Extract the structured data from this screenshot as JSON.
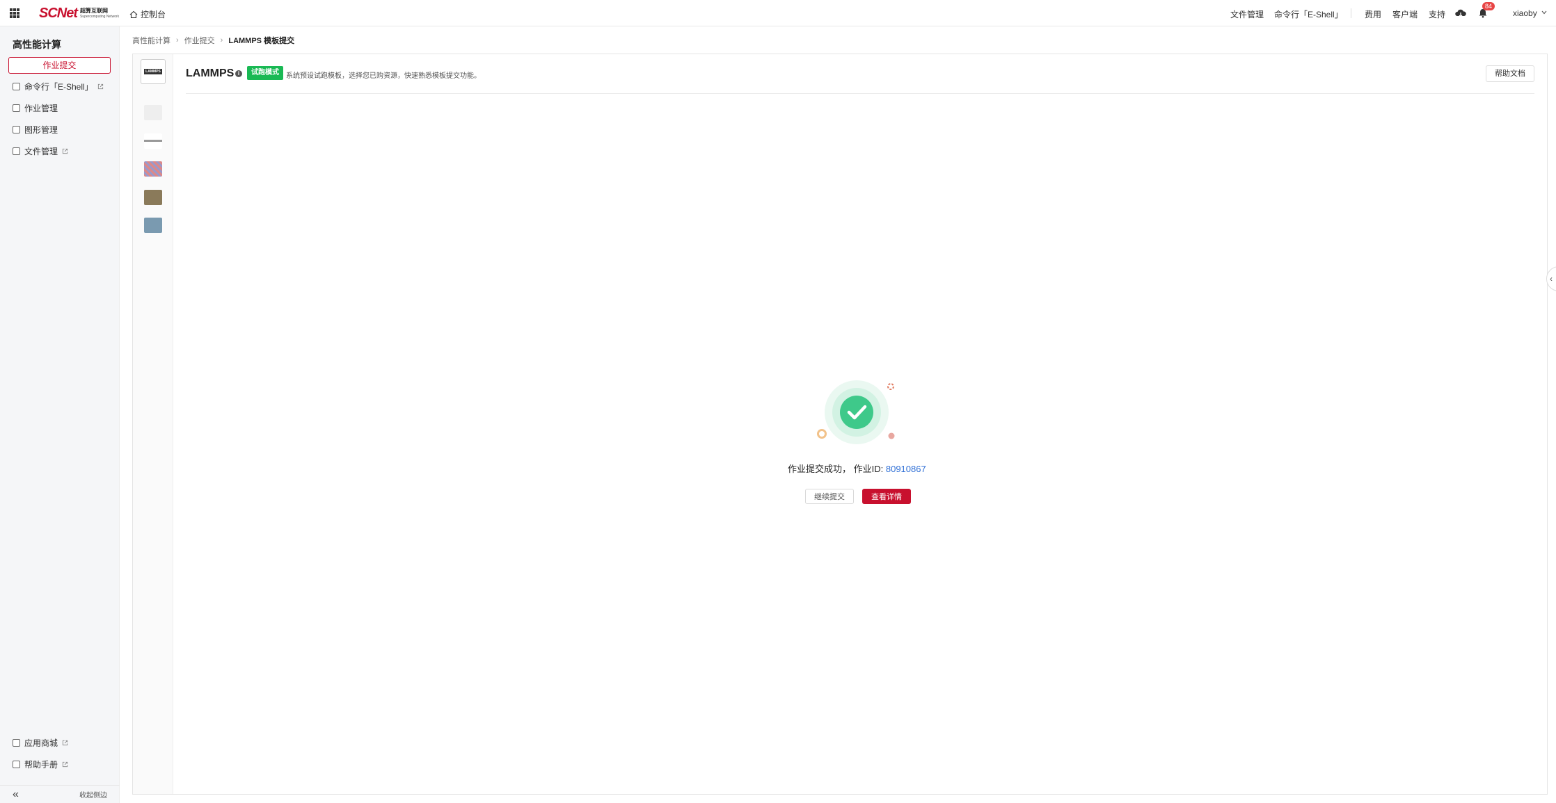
{
  "topbar": {
    "logo_text": "SCNet",
    "logo_cn": "超算互联网",
    "logo_en": "Supercomputing Network",
    "console_label": "控制台",
    "right": {
      "file_mgmt": "文件管理",
      "cli": "命令行「E-Shell」",
      "billing": "费用",
      "client": "客户端",
      "support": "支持",
      "notification_count": "84",
      "username": "xiaoby"
    }
  },
  "sidebar": {
    "title": "高性能计算",
    "submit_button": "作业提交",
    "items": [
      {
        "label": "命令行「E-Shell」",
        "external": true
      },
      {
        "label": "作业管理",
        "external": false
      },
      {
        "label": "图形管理",
        "external": false
      },
      {
        "label": "文件管理",
        "external": true
      }
    ],
    "bottom_items": [
      {
        "label": "应用商城",
        "external": true
      },
      {
        "label": "帮助手册",
        "external": true
      }
    ],
    "collapse_label": "收起侧边"
  },
  "breadcrumb": [
    "高性能计算",
    "作业提交",
    "LAMMPS 模板提交"
  ],
  "header": {
    "app_name": "LAMMPS",
    "thumb_label": "LAMMPS",
    "mode_tag": "试跑模式",
    "mode_desc": "系统预设试跑模板，选择您已购资源，快速熟悉模板提交功能。",
    "help_button": "帮助文档"
  },
  "result": {
    "message": "作业提交成功，  作业ID:",
    "job_id": "80910867",
    "continue_button": "继续提交",
    "detail_button": "查看详情"
  },
  "colors": {
    "brand": "#c8102e",
    "success": "#3ec98a",
    "tag_green": "#19b954",
    "link": "#2f6fd6"
  }
}
